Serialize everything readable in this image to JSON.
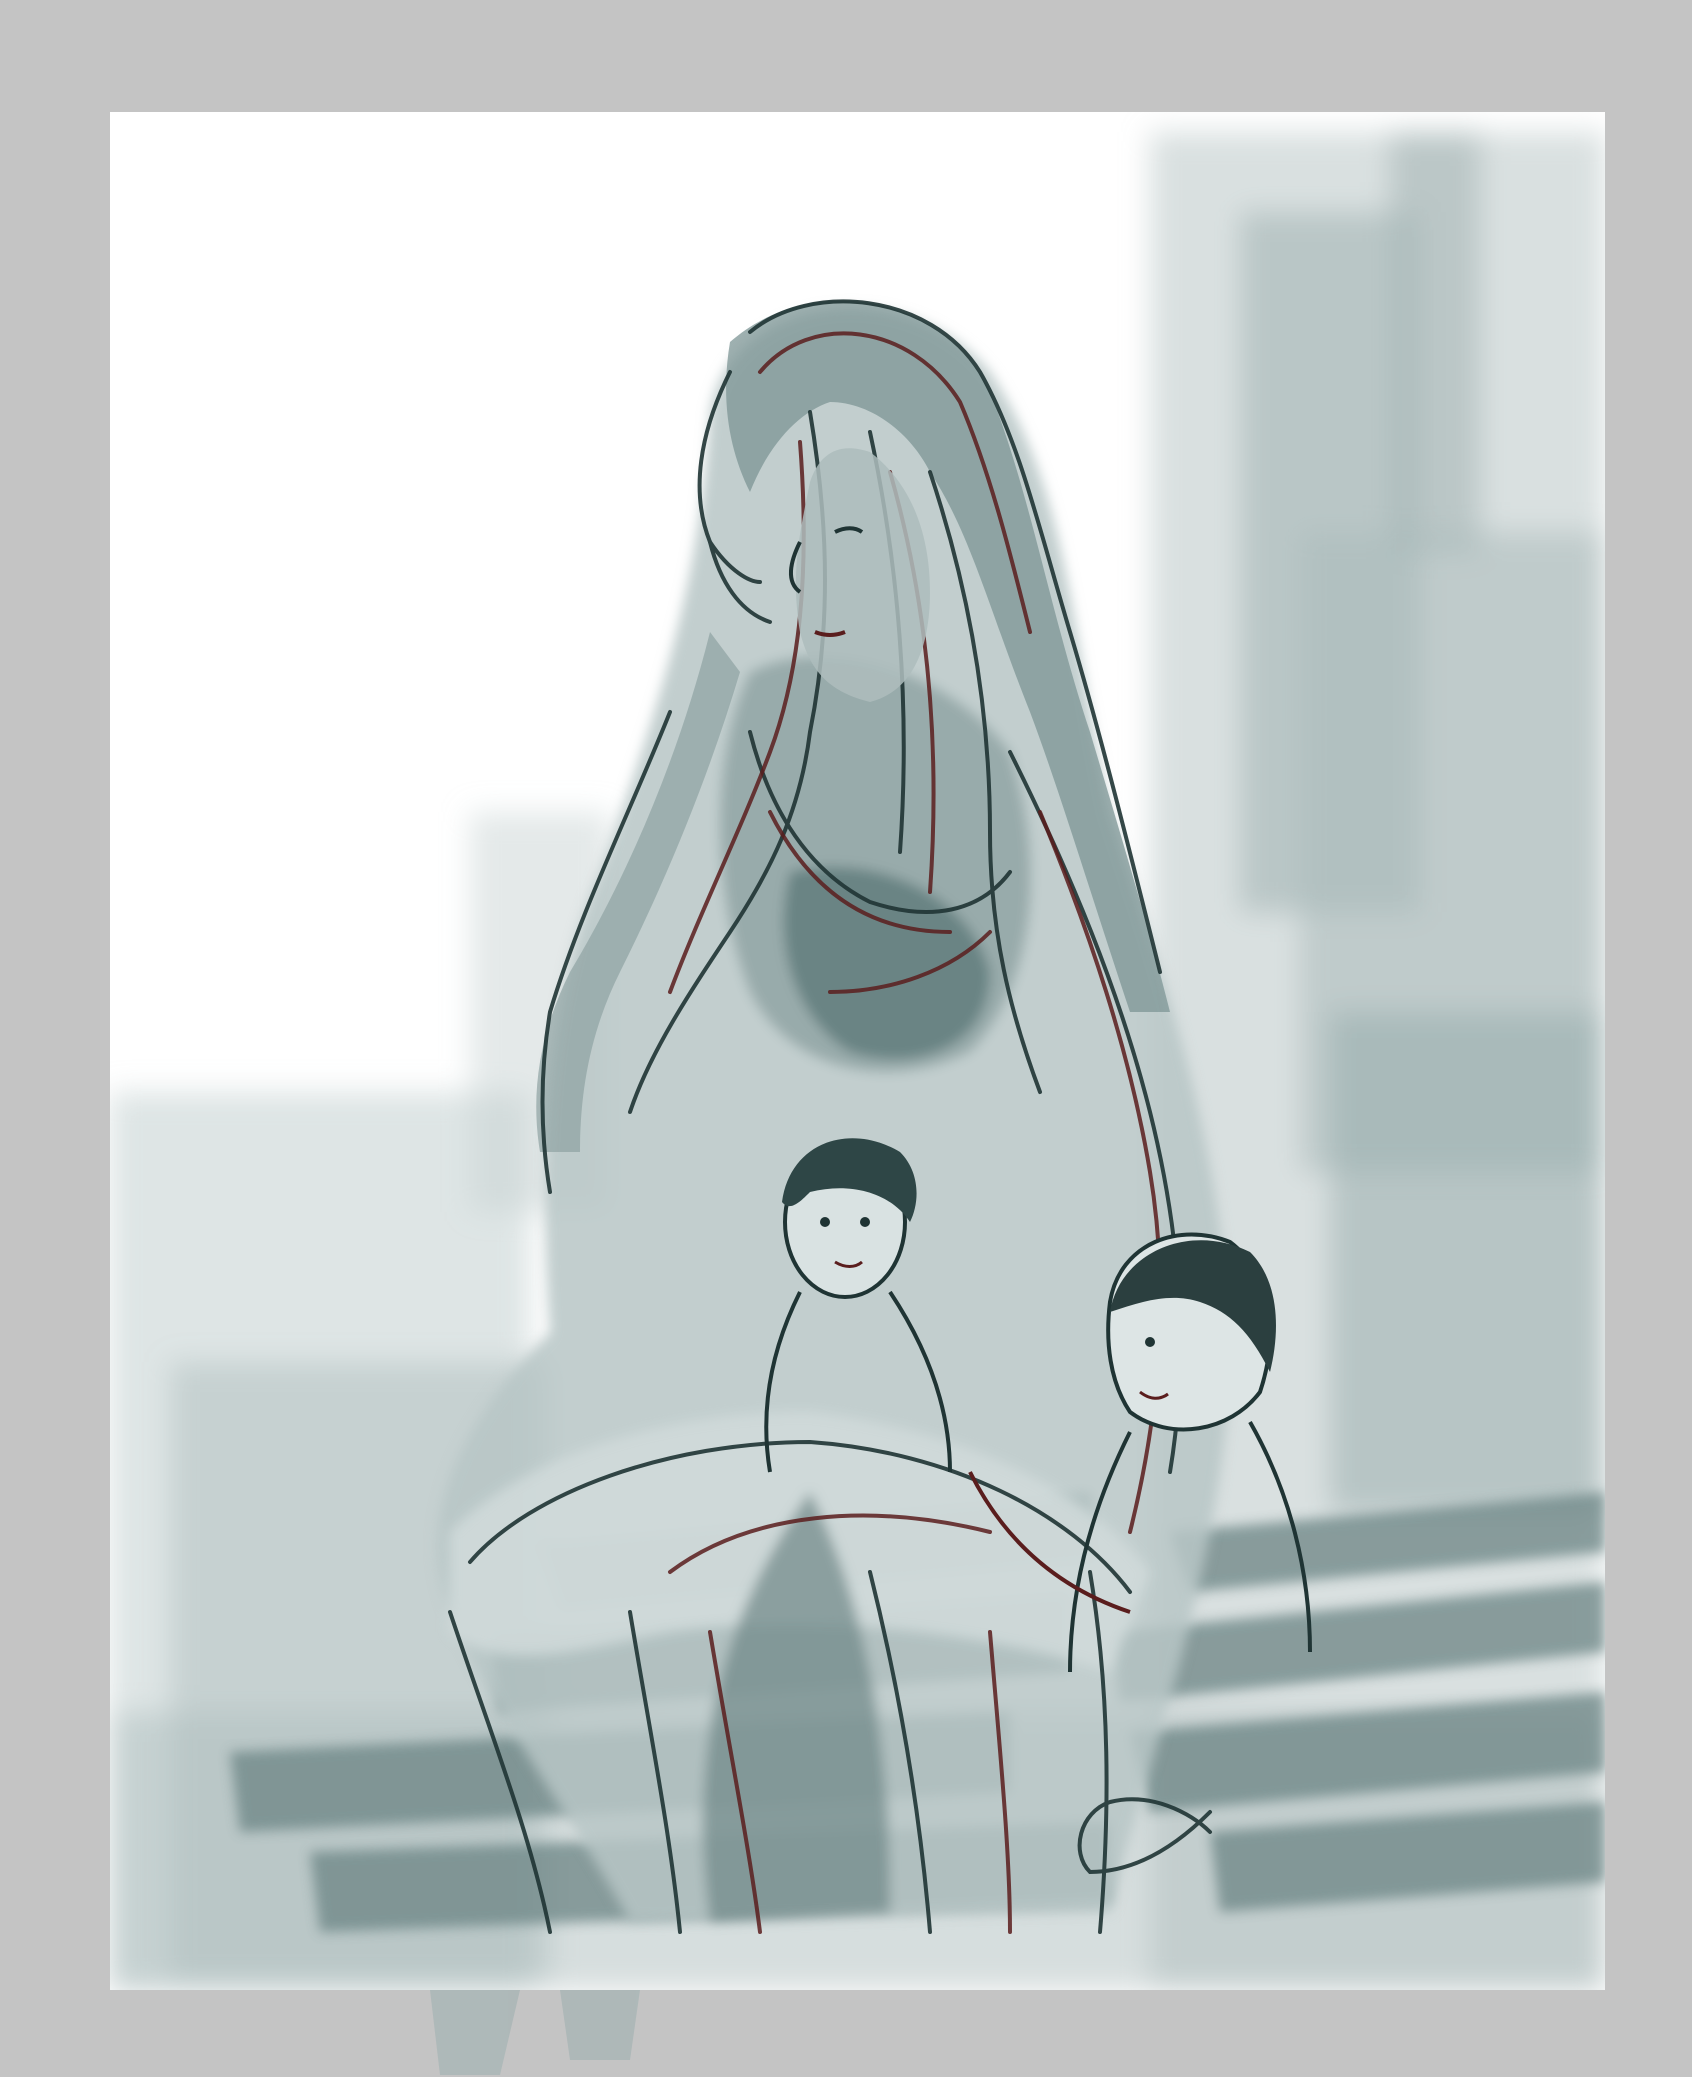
{
  "artwork": {
    "subject": "",
    "palette": {
      "page_background": "#c4c4c4",
      "paper": "#ffffff",
      "wash_light": "#b9c6c6",
      "wash_mid": "#8fa4a4",
      "wash_dark": "#4f6a6a",
      "ink_line": "#1f3434",
      "accent_line": "#5a1d1d"
    }
  }
}
